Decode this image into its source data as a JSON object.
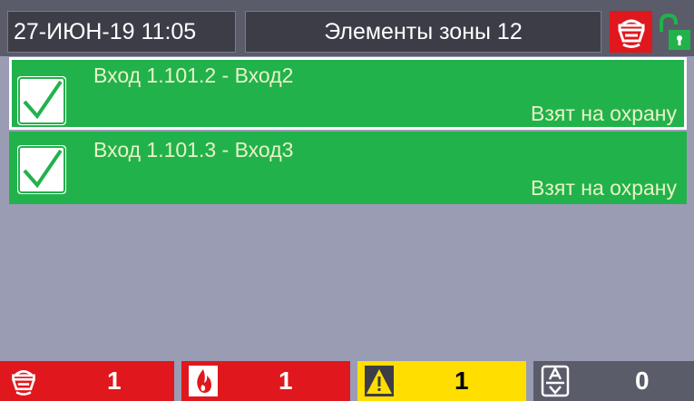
{
  "header": {
    "datetime": "27-ИЮН-19 11:05",
    "title": "Элементы зоны 12",
    "fire_icon": "fire-detector-icon",
    "lock_icon": "unlocked-padlock-icon"
  },
  "items": [
    {
      "name": "Вход 1.101.2 - Вход2",
      "state": "Взят на охрану",
      "icon": "checkmark-icon"
    },
    {
      "name": "Вход 1.101.3 - Вход3",
      "state": "Взят на охрану",
      "icon": "checkmark-icon"
    }
  ],
  "counters": [
    {
      "icon": "fire-detector-icon",
      "value": "1",
      "color": "#e0171c"
    },
    {
      "icon": "flame-icon",
      "value": "1",
      "color": "#e0171c"
    },
    {
      "icon": "warning-icon",
      "value": "1",
      "color": "#ffde00"
    },
    {
      "icon": "disconnected-detector-icon",
      "value": "0",
      "color": "#5a5c6a"
    }
  ],
  "colors": {
    "armed_green": "#22b24c",
    "alarm_red": "#e0171c",
    "warning_yellow": "#ffde00",
    "background": "#9a9cb4"
  }
}
